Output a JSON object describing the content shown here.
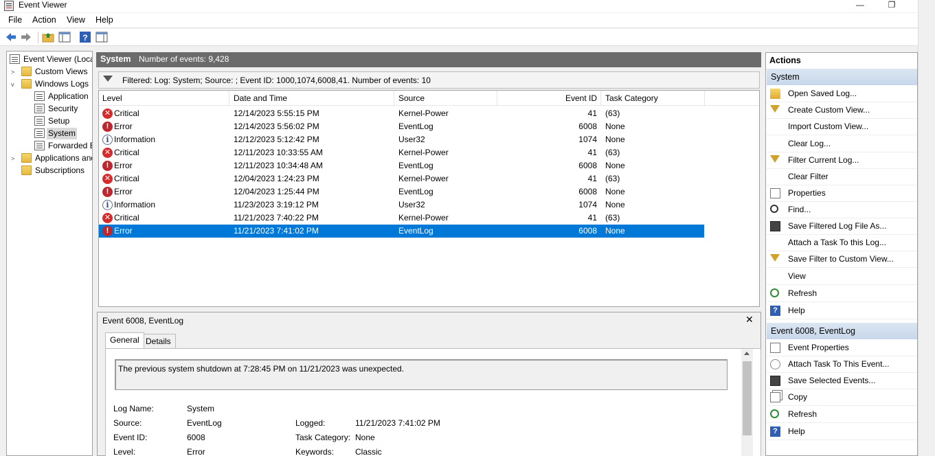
{
  "window": {
    "title": "Event Viewer",
    "minimize": "—",
    "restore": "❐"
  },
  "menu": [
    "File",
    "Action",
    "View",
    "Help"
  ],
  "tree": {
    "root": "Event Viewer (Local)",
    "custom_views": "Custom Views",
    "windows_logs": "Windows Logs",
    "application": "Application",
    "security": "Security",
    "setup": "Setup",
    "system": "System",
    "forwarded": "Forwarded Events",
    "apps_services": "Applications and Services Logs",
    "subscriptions": "Subscriptions"
  },
  "log_header": {
    "name": "System",
    "count_text": "Number of events: 9,428"
  },
  "filter_text": "Filtered: Log: System; Source: ; Event ID: 1000,1074,6008,41. Number of events: 10",
  "columns": [
    "Level",
    "Date and Time",
    "Source",
    "Event ID",
    "Task Category"
  ],
  "events": [
    {
      "level": "Critical",
      "date": "12/14/2023 5:55:15 PM",
      "source": "Kernel-Power",
      "id": "41",
      "task": "(63)"
    },
    {
      "level": "Error",
      "date": "12/14/2023 5:56:02 PM",
      "source": "EventLog",
      "id": "6008",
      "task": "None"
    },
    {
      "level": "Information",
      "date": "12/12/2023 5:12:42 PM",
      "source": "User32",
      "id": "1074",
      "task": "None"
    },
    {
      "level": "Critical",
      "date": "12/11/2023 10:33:55 AM",
      "source": "Kernel-Power",
      "id": "41",
      "task": "(63)"
    },
    {
      "level": "Error",
      "date": "12/11/2023 10:34:48 AM",
      "source": "EventLog",
      "id": "6008",
      "task": "None"
    },
    {
      "level": "Critical",
      "date": "12/04/2023 1:24:23 PM",
      "source": "Kernel-Power",
      "id": "41",
      "task": "(63)"
    },
    {
      "level": "Error",
      "date": "12/04/2023 1:25:44 PM",
      "source": "EventLog",
      "id": "6008",
      "task": "None"
    },
    {
      "level": "Information",
      "date": "11/23/2023 3:19:12 PM",
      "source": "User32",
      "id": "1074",
      "task": "None"
    },
    {
      "level": "Critical",
      "date": "11/21/2023 7:40:22 PM",
      "source": "Kernel-Power",
      "id": "41",
      "task": "(63)"
    },
    {
      "level": "Error",
      "date": "11/21/2023 7:41:02 PM",
      "source": "EventLog",
      "id": "6008",
      "task": "None"
    }
  ],
  "detail": {
    "title": "Event 6008, EventLog",
    "close": "✕",
    "tabs": [
      "General",
      "Details"
    ],
    "description": "The previous system shutdown at 7:28:45 PM on 11/21/2023 was unexpected.",
    "fields": {
      "log_name_label": "Log Name:",
      "log_name": "System",
      "source_label": "Source:",
      "source": "EventLog",
      "logged_label": "Logged:",
      "logged": "11/21/2023 7:41:02 PM",
      "event_id_label": "Event ID:",
      "event_id": "6008",
      "task_label": "Task Category:",
      "task": "None",
      "level_label": "Level:",
      "level": "Error",
      "keywords_label": "Keywords:",
      "keywords": "Classic"
    }
  },
  "actions": {
    "title": "Actions",
    "section1": "System",
    "items1": [
      {
        "label": "Open Saved Log...",
        "icon": "open-folder-icon"
      },
      {
        "label": "Create Custom View...",
        "icon": "filter-icon"
      },
      {
        "label": "Import Custom View...",
        "icon": ""
      },
      {
        "label": "Clear Log...",
        "icon": ""
      },
      {
        "label": "Filter Current Log...",
        "icon": "filter-icon"
      },
      {
        "label": "Clear Filter",
        "icon": ""
      },
      {
        "label": "Properties",
        "icon": "properties-icon"
      },
      {
        "label": "Find...",
        "icon": "binoculars-icon"
      },
      {
        "label": "Save Filtered Log File As...",
        "icon": "save-icon"
      },
      {
        "label": "Attach a Task To this Log...",
        "icon": ""
      },
      {
        "label": "Save Filter to Custom View...",
        "icon": "filter-icon"
      },
      {
        "label": "View",
        "icon": ""
      },
      {
        "label": "Refresh",
        "icon": "refresh-icon"
      },
      {
        "label": "Help",
        "icon": "help-icon"
      }
    ],
    "section2": "Event 6008, EventLog",
    "items2": [
      {
        "label": "Event Properties",
        "icon": "properties-icon"
      },
      {
        "label": "Attach Task To This Event...",
        "icon": "attach-task-icon"
      },
      {
        "label": "Save Selected Events...",
        "icon": "save-icon"
      },
      {
        "label": "Copy",
        "icon": "copy-icon"
      },
      {
        "label": "Refresh",
        "icon": "refresh-icon"
      },
      {
        "label": "Help",
        "icon": "help-icon"
      }
    ]
  },
  "colors": {
    "selection": "#0078d7",
    "header_bg": "#6b6b6b",
    "critical": "#d42b2b"
  }
}
